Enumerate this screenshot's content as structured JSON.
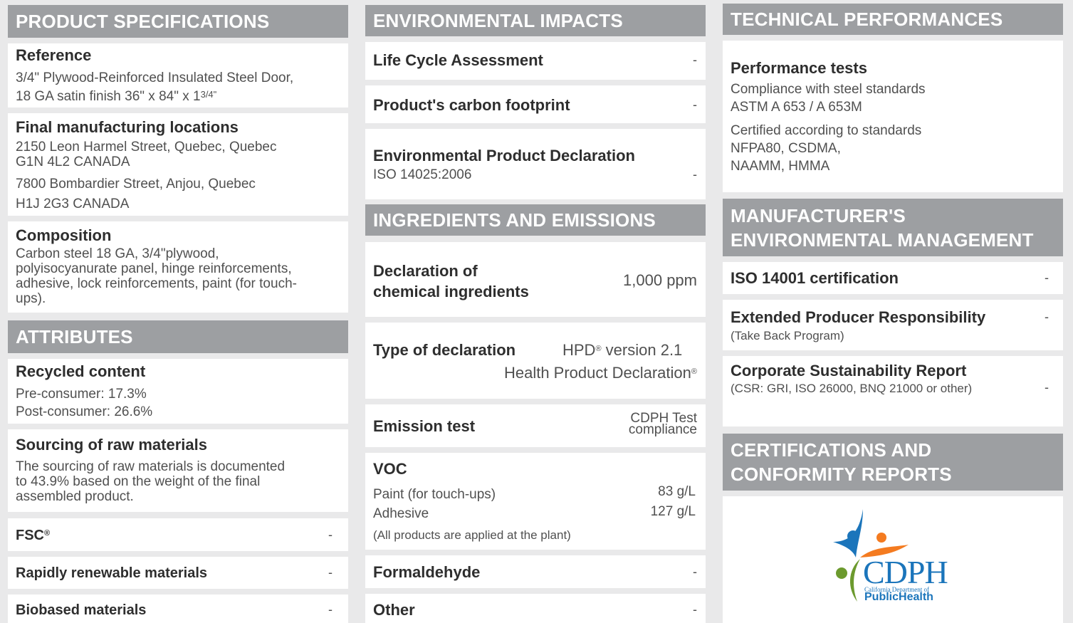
{
  "col1": {
    "product_specifications": {
      "header": "PRODUCT SPECIFICATIONS",
      "reference_title": "Reference",
      "reference_line1": "3/4\" Plywood-Reinforced Insulated Steel Door,",
      "reference_line2": "18 GA satin finish 36\" x 84\" x 1",
      "reference_fraction": "3/4\"",
      "locations_title": "Final manufacturing locations",
      "location1_line1": "2150 Leon Harmel Street, Quebec, Quebec",
      "location1_line2": "G1N 4L2 CANADA",
      "location2_line1": "7800 Bombardier Street, Anjou, Quebec",
      "location2_line2": "H1J 2G3 CANADA",
      "composition_title": "Composition",
      "composition_line1": "Carbon steel 18 GA, 3/4\"plywood,",
      "composition_line2": "polyisocyanurate panel, hinge reinforcements,",
      "composition_line3": "adhesive, lock reinforcements, paint (for touch-",
      "composition_line4": "ups)."
    },
    "attributes": {
      "header": "ATTRIBUTES",
      "recycled_title": "Recycled content",
      "pre_consumer": "Pre-consumer: 17.3%",
      "post_consumer": "Post-consumer: 26.6%",
      "sourcing_title": "Sourcing of raw materials",
      "sourcing_line1": "The sourcing of raw materials is documented",
      "sourcing_line2": "to 43.9% based on the weight of the final",
      "sourcing_line3": "assembled product.",
      "fsc_title": "FSC",
      "fsc_mark": "®",
      "fsc_value": "-",
      "rapidly_title": "Rapidly renewable materials",
      "rapidly_value": "-",
      "biobased_title": "Biobased materials",
      "biobased_value": "-"
    }
  },
  "col2": {
    "environmental_impacts": {
      "header": "ENVIRONMENTAL IMPACTS",
      "lca_title": "Life Cycle Assessment",
      "lca_value": "-",
      "carbon_title": "Product's carbon footprint",
      "carbon_value": "-",
      "epd_title": "Environmental Product Declaration",
      "epd_sub": "ISO 14025:2006",
      "epd_value": "-"
    },
    "ingredients_emissions": {
      "header": "INGREDIENTS AND EMISSIONS",
      "declaration_line1": "Declaration of",
      "declaration_line2": "chemical ingredients",
      "declaration_value": "1,000 ppm",
      "type_title": "Type of declaration",
      "type_value_line1": "HPD",
      "type_value_line1_mark": "®",
      "type_value_line1_rest": " version 2.1",
      "type_value_line2": "Health Product Declaration",
      "type_value_line2_mark": "®",
      "emission_title": "Emission test",
      "emission_value_line1": "CDPH Test",
      "emission_value_line2": "compliance",
      "voc_title": "VOC",
      "voc_item1_label": "Paint (for touch-ups)",
      "voc_item1_value": "83 g/L",
      "voc_item2_label": "Adhesive",
      "voc_item2_value": "127 g/L",
      "voc_note": "(All products are applied at the plant)",
      "formaldehyde_title": "Formaldehyde",
      "formaldehyde_value": "-",
      "other_title": "Other",
      "other_value": "-"
    }
  },
  "col3": {
    "technical_performances": {
      "header": "TECHNICAL PERFORMANCES",
      "tests_title": "Performance tests",
      "tests_line1": "Compliance with steel standards",
      "tests_line2": "ASTM A 653 / A 653M",
      "certified_line1": "Certified according to standards",
      "certified_line2": "NFPA80, CSDMA,",
      "certified_line3": "NAAMM, HMMA"
    },
    "manufacturer_management": {
      "header_line1": "MANUFACTURER'S",
      "header_line2": "ENVIRONMENTAL MANAGEMENT",
      "iso_title": "ISO 14001 certification",
      "iso_value": "-",
      "epr_title": "Extended Producer Responsibility",
      "epr_sub": "(Take Back Program)",
      "epr_value": "-",
      "csr_title": "Corporate Sustainability Report",
      "csr_sub": "(CSR: GRI, ISO 26000, BNQ 21000 or other)",
      "csr_value": "-"
    },
    "certifications": {
      "header_line1": "CERTIFICATIONS AND",
      "header_line2": "CONFORMITY REPORTS",
      "logo_text": "CDPH",
      "logo_sub": "California Department of",
      "logo_sub2a": "Public",
      "logo_sub2b": "Health",
      "logo_colors": {
        "blue": "#1b75bb",
        "orange": "#f47b20",
        "green": "#6c9a2e"
      }
    }
  }
}
